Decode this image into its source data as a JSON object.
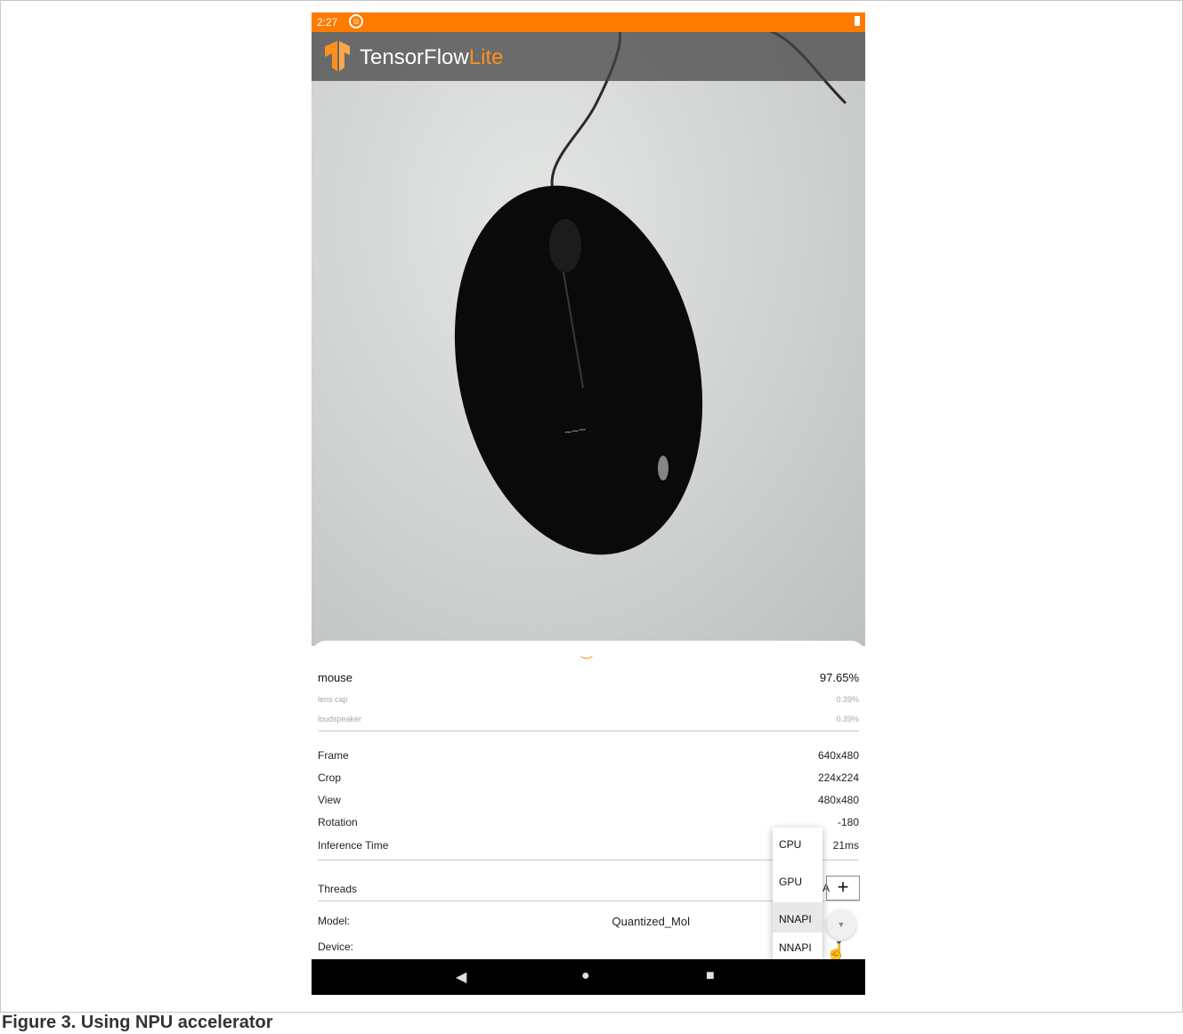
{
  "status_bar": {
    "time": "2:27"
  },
  "app_bar": {
    "title_main": "TensorFlow",
    "title_accent": "Lite"
  },
  "results": [
    {
      "label": "mouse",
      "value": "97.65%"
    },
    {
      "label": "lens cap",
      "value": "0.39%"
    },
    {
      "label": "loudspeaker",
      "value": "0.39%"
    }
  ],
  "info": {
    "frame": {
      "label": "Frame",
      "value": "640x480"
    },
    "crop": {
      "label": "Crop",
      "value": "224x224"
    },
    "view": {
      "label": "View",
      "value": "480x480"
    },
    "rotation": {
      "label": "Rotation",
      "value": "-180"
    },
    "inference": {
      "label": "Inference Time",
      "value": "21ms"
    }
  },
  "threads": {
    "label": "Threads",
    "partial": "A",
    "plus": "+"
  },
  "model": {
    "label": "Model:",
    "value": "Quantized_Mol"
  },
  "device": {
    "label": "Device:",
    "value": "NNAPI"
  },
  "device_options": [
    "CPU",
    "GPU",
    "NNAPI"
  ],
  "caption": "Figure 3.  Using NPU accelerator",
  "colors": {
    "status_bar": "#ff7b00",
    "accent": "#ff8f1f",
    "nav_bar": "#000000"
  }
}
